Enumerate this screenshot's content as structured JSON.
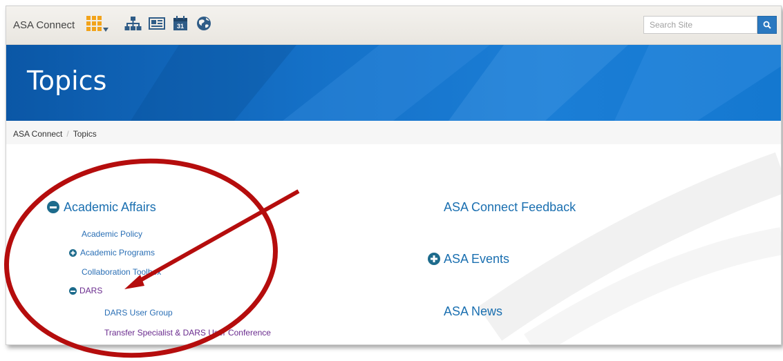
{
  "header": {
    "site_title": "ASA Connect",
    "icons": [
      "apps-grid-icon",
      "site-map-icon",
      "news-icon",
      "calendar-icon",
      "globe-icon"
    ],
    "calendar_day": "31",
    "search_placeholder": "Search Site"
  },
  "banner": {
    "title": "Topics"
  },
  "breadcrumb": {
    "items": [
      "ASA Connect",
      "Topics"
    ],
    "separator": "/"
  },
  "topics_left": {
    "title": "Academic Affairs",
    "items": [
      {
        "label": "Academic Policy"
      },
      {
        "label": "Academic Programs"
      },
      {
        "label": "Collaboration Toolbox"
      },
      {
        "label": "DARS"
      },
      {
        "label": "DARS User Group"
      },
      {
        "label": "Transfer Specialist & DARS User Conference"
      }
    ]
  },
  "topics_right": {
    "items": [
      {
        "label": "ASA Connect Feedback"
      },
      {
        "label": "ASA Events"
      },
      {
        "label": "ASA News"
      }
    ]
  },
  "colors": {
    "banner": "#1571c8",
    "link": "#2a6fb5",
    "visited_link": "#6a2b8e",
    "annotation": "#b50d0d",
    "expand_icon": "#1d6b8c"
  }
}
